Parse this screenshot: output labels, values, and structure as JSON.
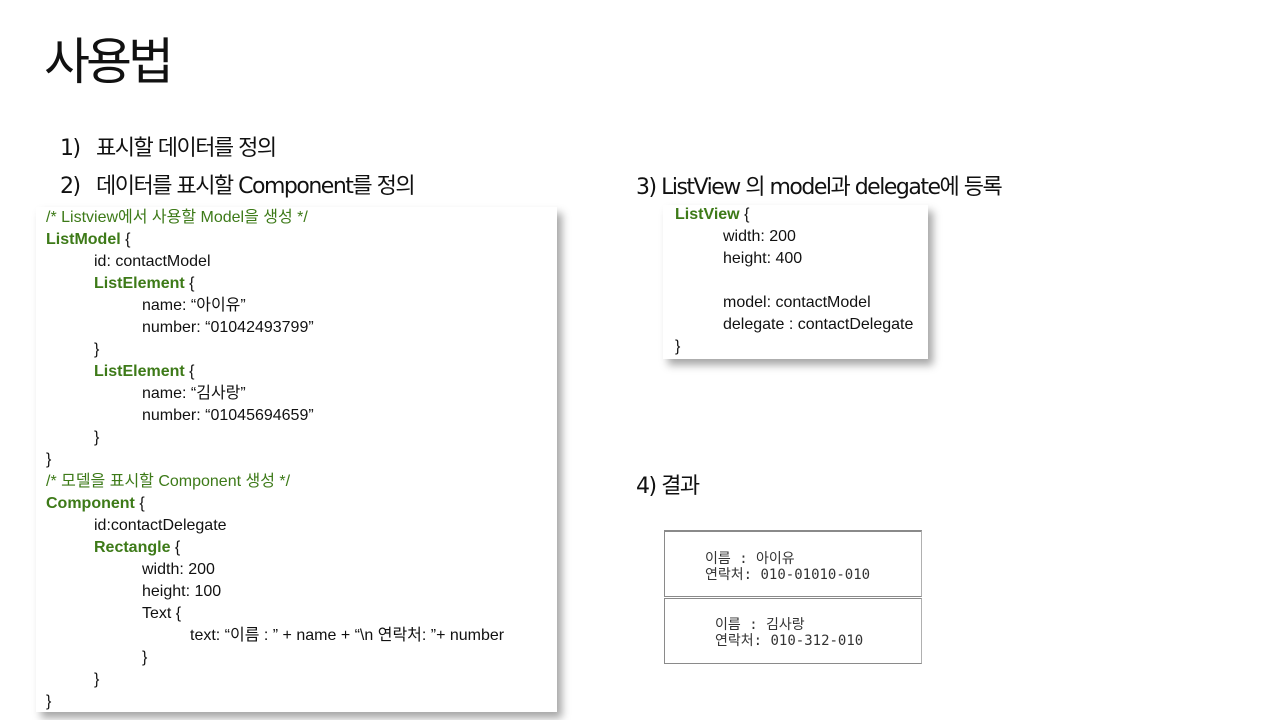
{
  "title": "사용법",
  "steps": [
    {
      "num": "1)",
      "text": "표시할 데이터를 정의"
    },
    {
      "num": "2)",
      "text": "데이터를 표시할 Component를 정의"
    },
    {
      "num": "3)",
      "text": "ListView 의 model과 delegate에 등록"
    },
    {
      "num": "4)",
      "text": "결과"
    }
  ],
  "code_main": [
    {
      "indent": 0,
      "parts": [
        {
          "t": "/* Listview에서 사용할 Model을 생성 */",
          "c": "cm"
        }
      ]
    },
    {
      "indent": 0,
      "parts": [
        {
          "t": "ListModel",
          "c": "kw"
        },
        {
          "t": " {",
          "c": ""
        }
      ]
    },
    {
      "indent": 1,
      "parts": [
        {
          "t": "id: contactModel",
          "c": ""
        }
      ]
    },
    {
      "indent": 1,
      "parts": [
        {
          "t": "ListElement",
          "c": "kw"
        },
        {
          "t": " {",
          "c": ""
        }
      ]
    },
    {
      "indent": 2,
      "parts": [
        {
          "t": "name: “아이유”",
          "c": ""
        }
      ]
    },
    {
      "indent": 2,
      "parts": [
        {
          "t": "number: “01042493799”",
          "c": ""
        }
      ]
    },
    {
      "indent": 1,
      "parts": [
        {
          "t": "}",
          "c": ""
        }
      ]
    },
    {
      "indent": 1,
      "parts": [
        {
          "t": "ListElement",
          "c": "kw"
        },
        {
          "t": " {",
          "c": ""
        }
      ]
    },
    {
      "indent": 2,
      "parts": [
        {
          "t": "name: “김사랑”",
          "c": ""
        }
      ]
    },
    {
      "indent": 2,
      "parts": [
        {
          "t": "number: “01045694659”",
          "c": ""
        }
      ]
    },
    {
      "indent": 1,
      "parts": [
        {
          "t": "}",
          "c": ""
        }
      ]
    },
    {
      "indent": 0,
      "parts": [
        {
          "t": "}",
          "c": ""
        }
      ]
    },
    {
      "indent": 0,
      "parts": [
        {
          "t": "/* 모델을 표시할 Component 생성 */",
          "c": "cm"
        }
      ]
    },
    {
      "indent": 0,
      "parts": [
        {
          "t": "Component",
          "c": "kw"
        },
        {
          "t": " {",
          "c": ""
        }
      ]
    },
    {
      "indent": 1,
      "parts": [
        {
          "t": "id:contactDelegate",
          "c": ""
        }
      ]
    },
    {
      "indent": 1,
      "parts": [
        {
          "t": "Rectangle",
          "c": "kw"
        },
        {
          "t": " {",
          "c": ""
        }
      ]
    },
    {
      "indent": 2,
      "parts": [
        {
          "t": "width: 200",
          "c": ""
        }
      ]
    },
    {
      "indent": 2,
      "parts": [
        {
          "t": "height: 100",
          "c": ""
        }
      ]
    },
    {
      "indent": 2,
      "parts": [
        {
          "t": "Text {",
          "c": ""
        }
      ]
    },
    {
      "indent": 3,
      "parts": [
        {
          "t": "text: “이름 : ” + name + “\\n 연락처: ”+ number",
          "c": ""
        }
      ]
    },
    {
      "indent": 2,
      "parts": [
        {
          "t": "}",
          "c": ""
        }
      ]
    },
    {
      "indent": 1,
      "parts": [
        {
          "t": "}",
          "c": ""
        }
      ]
    },
    {
      "indent": 0,
      "parts": [
        {
          "t": "}",
          "c": ""
        }
      ]
    }
  ],
  "code_listview": [
    {
      "indent": 0,
      "parts": [
        {
          "t": "ListView",
          "c": "kw"
        },
        {
          "t": " {",
          "c": ""
        }
      ]
    },
    {
      "indent": 1,
      "parts": [
        {
          "t": "width: 200",
          "c": ""
        }
      ]
    },
    {
      "indent": 1,
      "parts": [
        {
          "t": "height: 400",
          "c": ""
        }
      ]
    },
    {
      "indent": 1,
      "parts": [
        {
          "t": "",
          "c": ""
        }
      ]
    },
    {
      "indent": 1,
      "parts": [
        {
          "t": "model: contactModel",
          "c": ""
        }
      ]
    },
    {
      "indent": 1,
      "parts": [
        {
          "t": "delegate : contactDelegate",
          "c": ""
        }
      ]
    },
    {
      "indent": 0,
      "parts": [
        {
          "t": "}",
          "c": ""
        }
      ]
    }
  ],
  "result": [
    {
      "name_line": "이름 : 아이유",
      "phone_line": "연락처: 010-01010-010"
    },
    {
      "name_line": "이름 : 김사랑",
      "phone_line": "연락처: 010-312-010"
    }
  ],
  "colors": {
    "keyword": "#3d7a18",
    "comment": "#3d7a18",
    "text": "#111111"
  }
}
